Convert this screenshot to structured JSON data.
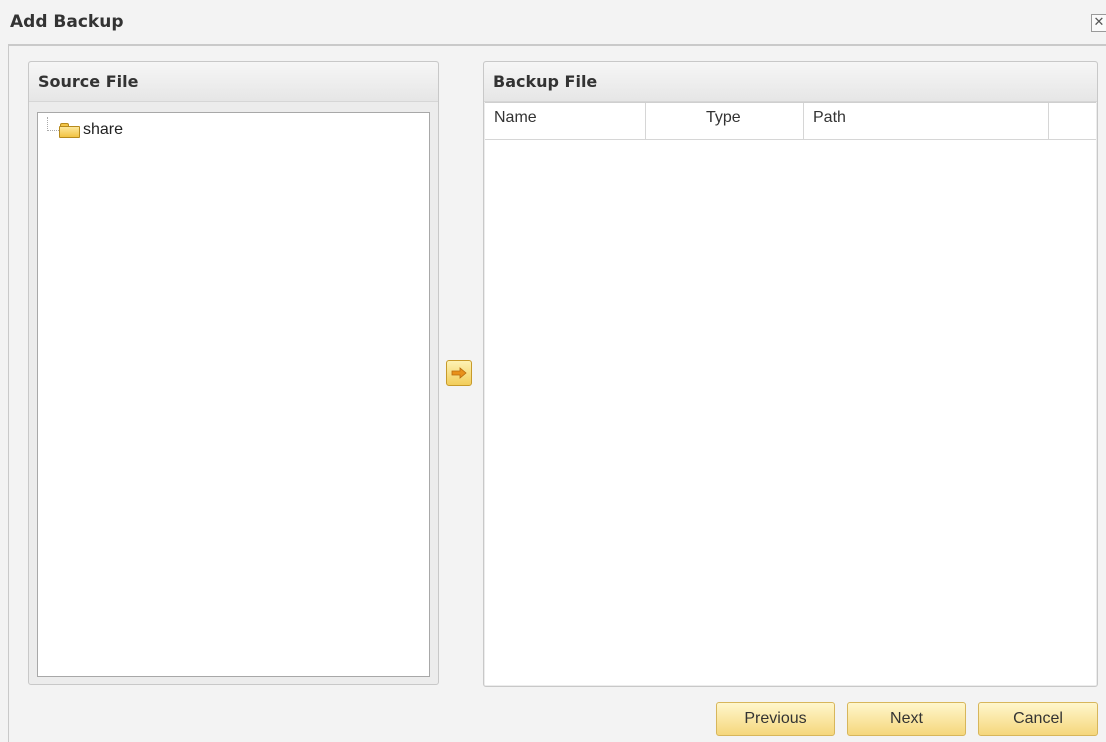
{
  "window": {
    "title": "Add Backup",
    "close_symbol": "✕"
  },
  "source_panel": {
    "title": "Source File",
    "tree": [
      {
        "label": "share",
        "icon": "folder-icon"
      }
    ]
  },
  "backup_panel": {
    "title": "Backup File",
    "columns": [
      "Name",
      "Type",
      "Path",
      ""
    ]
  },
  "move_button": {
    "icon": "arrow-right-icon"
  },
  "footer": {
    "previous_label": "Previous",
    "next_label": "Next",
    "cancel_label": "Cancel"
  },
  "colors": {
    "button_accent": "#f5d77c",
    "arrow": "#e8901a"
  }
}
